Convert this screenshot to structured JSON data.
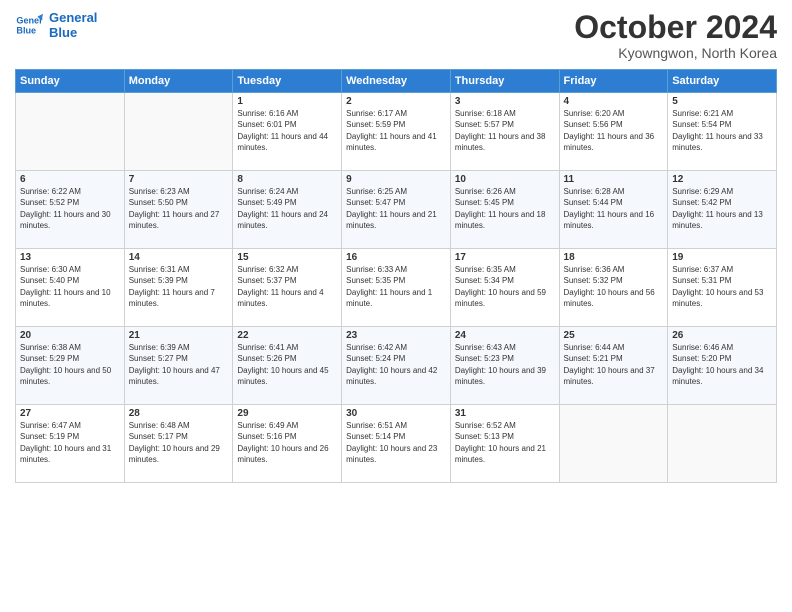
{
  "logo": {
    "line1": "General",
    "line2": "Blue"
  },
  "header": {
    "month": "October 2024",
    "location": "Kyowngwon, North Korea"
  },
  "days_of_week": [
    "Sunday",
    "Monday",
    "Tuesday",
    "Wednesday",
    "Thursday",
    "Friday",
    "Saturday"
  ],
  "weeks": [
    [
      {
        "day": "",
        "content": ""
      },
      {
        "day": "",
        "content": ""
      },
      {
        "day": "1",
        "content": "Sunrise: 6:16 AM\nSunset: 6:01 PM\nDaylight: 11 hours and 44 minutes."
      },
      {
        "day": "2",
        "content": "Sunrise: 6:17 AM\nSunset: 5:59 PM\nDaylight: 11 hours and 41 minutes."
      },
      {
        "day": "3",
        "content": "Sunrise: 6:18 AM\nSunset: 5:57 PM\nDaylight: 11 hours and 38 minutes."
      },
      {
        "day": "4",
        "content": "Sunrise: 6:20 AM\nSunset: 5:56 PM\nDaylight: 11 hours and 36 minutes."
      },
      {
        "day": "5",
        "content": "Sunrise: 6:21 AM\nSunset: 5:54 PM\nDaylight: 11 hours and 33 minutes."
      }
    ],
    [
      {
        "day": "6",
        "content": "Sunrise: 6:22 AM\nSunset: 5:52 PM\nDaylight: 11 hours and 30 minutes."
      },
      {
        "day": "7",
        "content": "Sunrise: 6:23 AM\nSunset: 5:50 PM\nDaylight: 11 hours and 27 minutes."
      },
      {
        "day": "8",
        "content": "Sunrise: 6:24 AM\nSunset: 5:49 PM\nDaylight: 11 hours and 24 minutes."
      },
      {
        "day": "9",
        "content": "Sunrise: 6:25 AM\nSunset: 5:47 PM\nDaylight: 11 hours and 21 minutes."
      },
      {
        "day": "10",
        "content": "Sunrise: 6:26 AM\nSunset: 5:45 PM\nDaylight: 11 hours and 18 minutes."
      },
      {
        "day": "11",
        "content": "Sunrise: 6:28 AM\nSunset: 5:44 PM\nDaylight: 11 hours and 16 minutes."
      },
      {
        "day": "12",
        "content": "Sunrise: 6:29 AM\nSunset: 5:42 PM\nDaylight: 11 hours and 13 minutes."
      }
    ],
    [
      {
        "day": "13",
        "content": "Sunrise: 6:30 AM\nSunset: 5:40 PM\nDaylight: 11 hours and 10 minutes."
      },
      {
        "day": "14",
        "content": "Sunrise: 6:31 AM\nSunset: 5:39 PM\nDaylight: 11 hours and 7 minutes."
      },
      {
        "day": "15",
        "content": "Sunrise: 6:32 AM\nSunset: 5:37 PM\nDaylight: 11 hours and 4 minutes."
      },
      {
        "day": "16",
        "content": "Sunrise: 6:33 AM\nSunset: 5:35 PM\nDaylight: 11 hours and 1 minute."
      },
      {
        "day": "17",
        "content": "Sunrise: 6:35 AM\nSunset: 5:34 PM\nDaylight: 10 hours and 59 minutes."
      },
      {
        "day": "18",
        "content": "Sunrise: 6:36 AM\nSunset: 5:32 PM\nDaylight: 10 hours and 56 minutes."
      },
      {
        "day": "19",
        "content": "Sunrise: 6:37 AM\nSunset: 5:31 PM\nDaylight: 10 hours and 53 minutes."
      }
    ],
    [
      {
        "day": "20",
        "content": "Sunrise: 6:38 AM\nSunset: 5:29 PM\nDaylight: 10 hours and 50 minutes."
      },
      {
        "day": "21",
        "content": "Sunrise: 6:39 AM\nSunset: 5:27 PM\nDaylight: 10 hours and 47 minutes."
      },
      {
        "day": "22",
        "content": "Sunrise: 6:41 AM\nSunset: 5:26 PM\nDaylight: 10 hours and 45 minutes."
      },
      {
        "day": "23",
        "content": "Sunrise: 6:42 AM\nSunset: 5:24 PM\nDaylight: 10 hours and 42 minutes."
      },
      {
        "day": "24",
        "content": "Sunrise: 6:43 AM\nSunset: 5:23 PM\nDaylight: 10 hours and 39 minutes."
      },
      {
        "day": "25",
        "content": "Sunrise: 6:44 AM\nSunset: 5:21 PM\nDaylight: 10 hours and 37 minutes."
      },
      {
        "day": "26",
        "content": "Sunrise: 6:46 AM\nSunset: 5:20 PM\nDaylight: 10 hours and 34 minutes."
      }
    ],
    [
      {
        "day": "27",
        "content": "Sunrise: 6:47 AM\nSunset: 5:19 PM\nDaylight: 10 hours and 31 minutes."
      },
      {
        "day": "28",
        "content": "Sunrise: 6:48 AM\nSunset: 5:17 PM\nDaylight: 10 hours and 29 minutes."
      },
      {
        "day": "29",
        "content": "Sunrise: 6:49 AM\nSunset: 5:16 PM\nDaylight: 10 hours and 26 minutes."
      },
      {
        "day": "30",
        "content": "Sunrise: 6:51 AM\nSunset: 5:14 PM\nDaylight: 10 hours and 23 minutes."
      },
      {
        "day": "31",
        "content": "Sunrise: 6:52 AM\nSunset: 5:13 PM\nDaylight: 10 hours and 21 minutes."
      },
      {
        "day": "",
        "content": ""
      },
      {
        "day": "",
        "content": ""
      }
    ]
  ]
}
